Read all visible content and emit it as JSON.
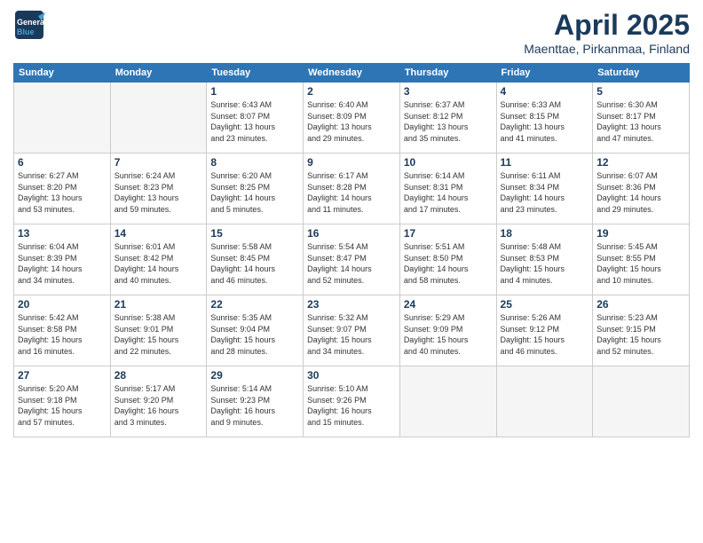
{
  "logo": {
    "line1": "General",
    "line2": "Blue"
  },
  "title": "April 2025",
  "subtitle": "Maenttae, Pirkanmaa, Finland",
  "days_header": [
    "Sunday",
    "Monday",
    "Tuesday",
    "Wednesday",
    "Thursday",
    "Friday",
    "Saturday"
  ],
  "weeks": [
    [
      {
        "day": "",
        "info": ""
      },
      {
        "day": "",
        "info": ""
      },
      {
        "day": "1",
        "info": "Sunrise: 6:43 AM\nSunset: 8:07 PM\nDaylight: 13 hours\nand 23 minutes."
      },
      {
        "day": "2",
        "info": "Sunrise: 6:40 AM\nSunset: 8:09 PM\nDaylight: 13 hours\nand 29 minutes."
      },
      {
        "day": "3",
        "info": "Sunrise: 6:37 AM\nSunset: 8:12 PM\nDaylight: 13 hours\nand 35 minutes."
      },
      {
        "day": "4",
        "info": "Sunrise: 6:33 AM\nSunset: 8:15 PM\nDaylight: 13 hours\nand 41 minutes."
      },
      {
        "day": "5",
        "info": "Sunrise: 6:30 AM\nSunset: 8:17 PM\nDaylight: 13 hours\nand 47 minutes."
      }
    ],
    [
      {
        "day": "6",
        "info": "Sunrise: 6:27 AM\nSunset: 8:20 PM\nDaylight: 13 hours\nand 53 minutes."
      },
      {
        "day": "7",
        "info": "Sunrise: 6:24 AM\nSunset: 8:23 PM\nDaylight: 13 hours\nand 59 minutes."
      },
      {
        "day": "8",
        "info": "Sunrise: 6:20 AM\nSunset: 8:25 PM\nDaylight: 14 hours\nand 5 minutes."
      },
      {
        "day": "9",
        "info": "Sunrise: 6:17 AM\nSunset: 8:28 PM\nDaylight: 14 hours\nand 11 minutes."
      },
      {
        "day": "10",
        "info": "Sunrise: 6:14 AM\nSunset: 8:31 PM\nDaylight: 14 hours\nand 17 minutes."
      },
      {
        "day": "11",
        "info": "Sunrise: 6:11 AM\nSunset: 8:34 PM\nDaylight: 14 hours\nand 23 minutes."
      },
      {
        "day": "12",
        "info": "Sunrise: 6:07 AM\nSunset: 8:36 PM\nDaylight: 14 hours\nand 29 minutes."
      }
    ],
    [
      {
        "day": "13",
        "info": "Sunrise: 6:04 AM\nSunset: 8:39 PM\nDaylight: 14 hours\nand 34 minutes."
      },
      {
        "day": "14",
        "info": "Sunrise: 6:01 AM\nSunset: 8:42 PM\nDaylight: 14 hours\nand 40 minutes."
      },
      {
        "day": "15",
        "info": "Sunrise: 5:58 AM\nSunset: 8:45 PM\nDaylight: 14 hours\nand 46 minutes."
      },
      {
        "day": "16",
        "info": "Sunrise: 5:54 AM\nSunset: 8:47 PM\nDaylight: 14 hours\nand 52 minutes."
      },
      {
        "day": "17",
        "info": "Sunrise: 5:51 AM\nSunset: 8:50 PM\nDaylight: 14 hours\nand 58 minutes."
      },
      {
        "day": "18",
        "info": "Sunrise: 5:48 AM\nSunset: 8:53 PM\nDaylight: 15 hours\nand 4 minutes."
      },
      {
        "day": "19",
        "info": "Sunrise: 5:45 AM\nSunset: 8:55 PM\nDaylight: 15 hours\nand 10 minutes."
      }
    ],
    [
      {
        "day": "20",
        "info": "Sunrise: 5:42 AM\nSunset: 8:58 PM\nDaylight: 15 hours\nand 16 minutes."
      },
      {
        "day": "21",
        "info": "Sunrise: 5:38 AM\nSunset: 9:01 PM\nDaylight: 15 hours\nand 22 minutes."
      },
      {
        "day": "22",
        "info": "Sunrise: 5:35 AM\nSunset: 9:04 PM\nDaylight: 15 hours\nand 28 minutes."
      },
      {
        "day": "23",
        "info": "Sunrise: 5:32 AM\nSunset: 9:07 PM\nDaylight: 15 hours\nand 34 minutes."
      },
      {
        "day": "24",
        "info": "Sunrise: 5:29 AM\nSunset: 9:09 PM\nDaylight: 15 hours\nand 40 minutes."
      },
      {
        "day": "25",
        "info": "Sunrise: 5:26 AM\nSunset: 9:12 PM\nDaylight: 15 hours\nand 46 minutes."
      },
      {
        "day": "26",
        "info": "Sunrise: 5:23 AM\nSunset: 9:15 PM\nDaylight: 15 hours\nand 52 minutes."
      }
    ],
    [
      {
        "day": "27",
        "info": "Sunrise: 5:20 AM\nSunset: 9:18 PM\nDaylight: 15 hours\nand 57 minutes."
      },
      {
        "day": "28",
        "info": "Sunrise: 5:17 AM\nSunset: 9:20 PM\nDaylight: 16 hours\nand 3 minutes."
      },
      {
        "day": "29",
        "info": "Sunrise: 5:14 AM\nSunset: 9:23 PM\nDaylight: 16 hours\nand 9 minutes."
      },
      {
        "day": "30",
        "info": "Sunrise: 5:10 AM\nSunset: 9:26 PM\nDaylight: 16 hours\nand 15 minutes."
      },
      {
        "day": "",
        "info": ""
      },
      {
        "day": "",
        "info": ""
      },
      {
        "day": "",
        "info": ""
      }
    ]
  ]
}
